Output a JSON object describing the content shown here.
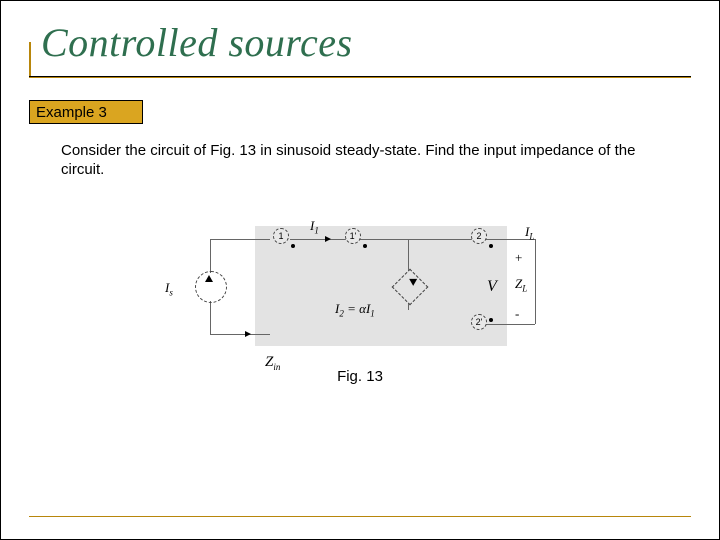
{
  "title": "Controlled sources",
  "example_label": "Example 3",
  "body_text": "Consider the circuit of Fig. 13 in sinusoid steady-state. Find the input impedance of the circuit.",
  "fig_caption": "Fig. 13",
  "circuit": {
    "node1": "1",
    "node1p": "1'",
    "node2": "2",
    "node2p": "2'",
    "I1": "I",
    "I1_sub": "1",
    "IL": "I",
    "IL_sub": "L",
    "Is": "I",
    "Is_sub": "s",
    "V": "V",
    "ZL": "Z",
    "ZL_sub": "L",
    "Zin": "Z",
    "Zin_sub": "in",
    "ccs_label": "I₂ = αI₁",
    "plus": "+",
    "minus": "-"
  }
}
